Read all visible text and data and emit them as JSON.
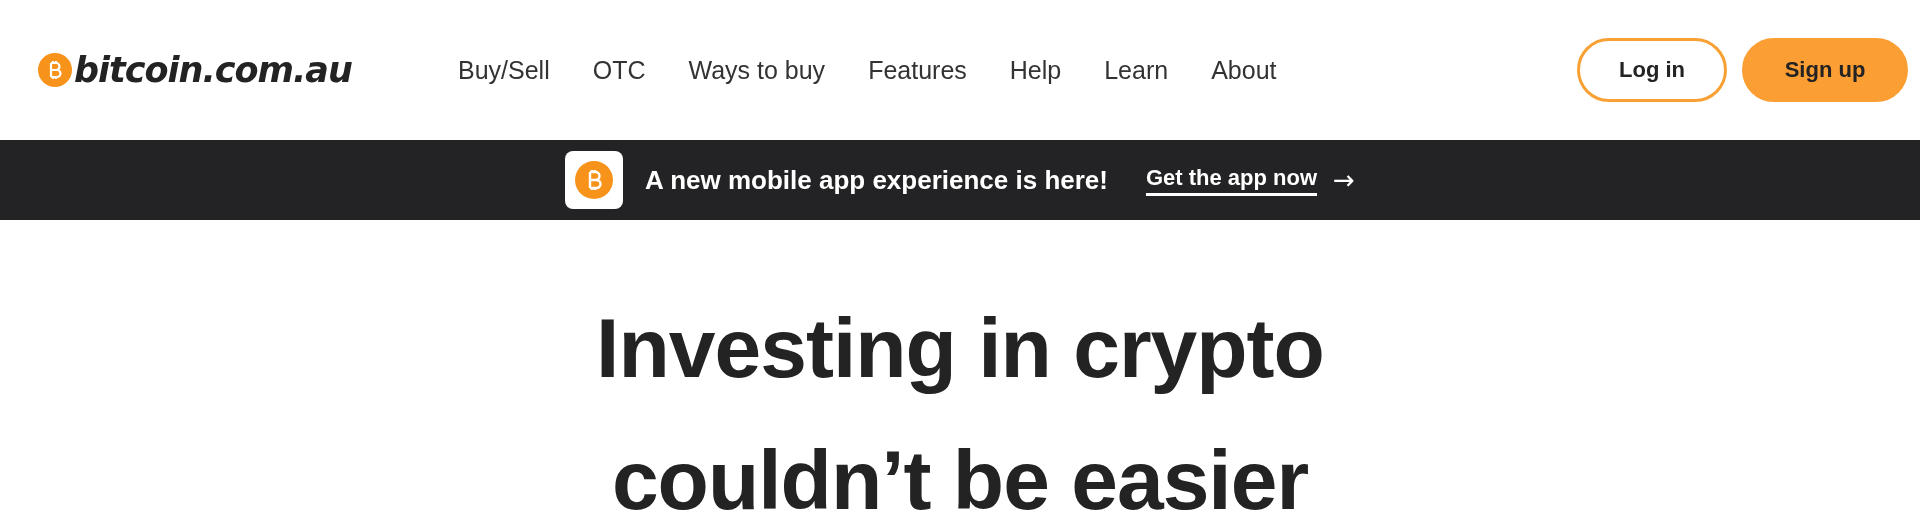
{
  "header": {
    "logo": "bitcoin.com.au",
    "nav": [
      "Buy/Sell",
      "OTC",
      "Ways to buy",
      "Features",
      "Help",
      "Learn",
      "About"
    ],
    "login": "Log in",
    "signup": "Sign up"
  },
  "banner": {
    "text": "A new mobile app experience is here!",
    "link": "Get the app now",
    "arrow": "→"
  },
  "hero": {
    "lines": [
      "Investing in crypto",
      "couldn’t be easier"
    ]
  }
}
